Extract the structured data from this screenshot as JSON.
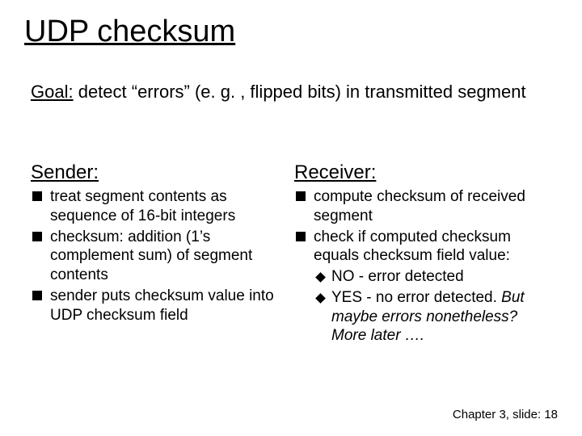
{
  "title": "UDP checksum",
  "goal": {
    "label": "Goal:",
    "text": " detect “errors” (e. g. , flipped bits) in transmitted segment"
  },
  "sender": {
    "heading": "Sender:",
    "b1": "treat segment contents as sequence of 16-bit integers",
    "b2": "checksum: addition (1’s complement sum) of segment contents",
    "b3": "sender puts checksum value into UDP checksum field"
  },
  "receiver": {
    "heading": "Receiver:",
    "b1": "compute checksum of received segment",
    "b2": "check if computed checksum equals checksum field value:",
    "s1": "NO - error detected",
    "s2a": "YES - no error detected. ",
    "s2b": "But maybe errors nonetheless? More later …."
  },
  "footer": {
    "prefix": "Chapter 3, slide: ",
    "num": "18"
  }
}
